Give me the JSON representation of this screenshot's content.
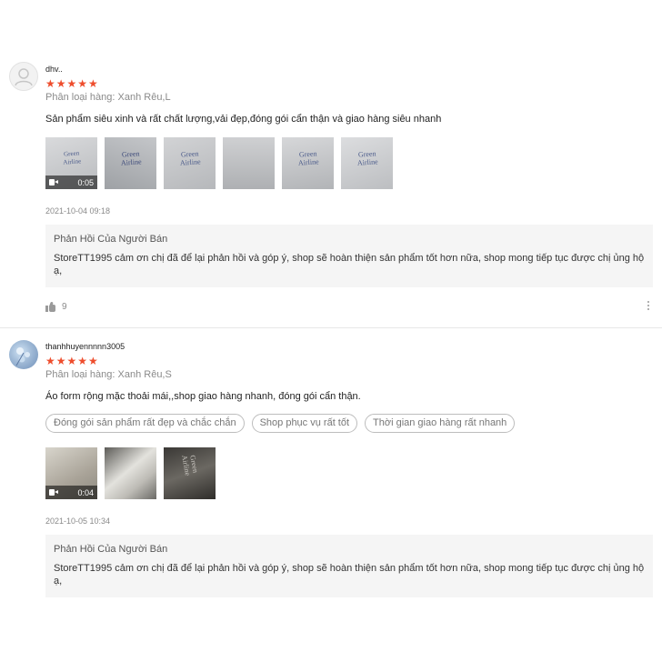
{
  "reviews": [
    {
      "username": "dhv..",
      "stars": "★★★★★",
      "rating": 5,
      "variant": "Phân loại hàng: Xanh Rêu,L",
      "comment": "Sản phẩm siêu xinh và rất chất lượng,vải đẹp,đóng gói cẩn thận và giao hàng siêu nhanh",
      "video_duration": "0:05",
      "timestamp": "2021-10-04 09:18",
      "reply_title": "Phản Hồi Của Người Bán",
      "reply_text": "StoreTT1995 cảm ơn chị đã để lại phản hồi và góp ý, shop sẽ hoàn thiện sản phẩm tốt hơn nữa, shop mong tiếp tục được chị ủng hộ ạ,",
      "likes": "9"
    },
    {
      "username": "thanhhuyennnnn3005",
      "stars": "★★★★★",
      "rating": 5,
      "variant": "Phân loại hàng: Xanh Rêu,S",
      "comment": "Áo form rộng mặc thoải mái,,shop giao hàng nhanh, đóng gói cẩn thận.",
      "tags": [
        "Đóng gói sản phẩm rất đẹp và chắc chắn",
        "Shop phục vụ rất tốt",
        "Thời gian giao hàng rất nhanh"
      ],
      "video_duration": "0:04",
      "timestamp": "2021-10-05 10:34",
      "reply_title": "Phản Hồi Của Người Bán",
      "reply_text": "StoreTT1995 cảm ơn chị đã để lại phản hồi và góp ý, shop sẽ hoàn thiện sản phẩm tốt hơn nữa, shop mong tiếp tục được chị ủng hộ ạ,"
    }
  ],
  "colors": {
    "star": "#ee4d2d",
    "reply_bg": "#f5f5f5",
    "muted_text": "#8a8a8a"
  }
}
